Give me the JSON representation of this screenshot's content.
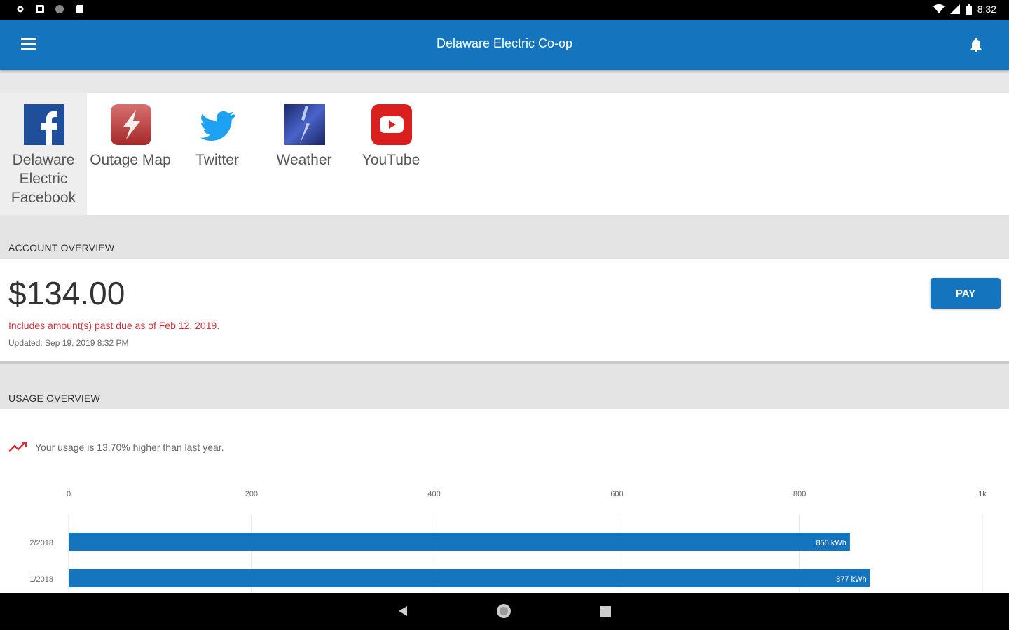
{
  "status_bar": {
    "time": "8:32"
  },
  "app_bar": {
    "title": "Delaware Electric Co-op"
  },
  "shortcuts": [
    {
      "label": "Delaware Electric Facebook",
      "icon": "facebook-icon"
    },
    {
      "label": "Outage Map",
      "icon": "outage-map-icon"
    },
    {
      "label": "Twitter",
      "icon": "twitter-icon"
    },
    {
      "label": "Weather",
      "icon": "weather-icon"
    },
    {
      "label": "YouTube",
      "icon": "youtube-icon"
    }
  ],
  "account": {
    "section_title": "ACCOUNT OVERVIEW",
    "amount": "$134.00",
    "past_due_note": "Includes amount(s) past due as of Feb 12, 2019.",
    "updated": "Updated:  Sep 19, 2019 8:32 PM",
    "pay_label": "PAY"
  },
  "usage": {
    "section_title": "USAGE OVERVIEW",
    "trend_text": "Your usage is 13.70% higher than last year.",
    "trend_icon": "trending-up-icon"
  },
  "colors": {
    "primary": "#1474be",
    "alert": "#d3313a"
  },
  "chart_data": {
    "type": "bar",
    "orientation": "horizontal",
    "categories": [
      "2/2018",
      "1/2018"
    ],
    "values": [
      855,
      877
    ],
    "data_labels": [
      "855 kWh",
      "877 kWh"
    ],
    "x_ticks": [
      "0",
      "200",
      "400",
      "600",
      "800",
      "1k"
    ],
    "xlim": [
      0,
      1000
    ],
    "grid": true
  }
}
